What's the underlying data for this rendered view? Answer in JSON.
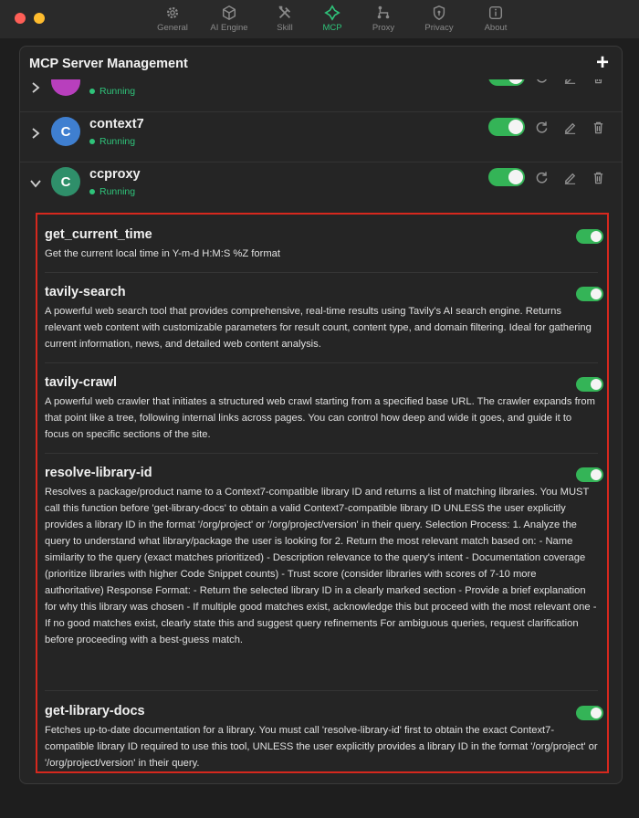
{
  "tabs": [
    {
      "label": "General",
      "icon": "gear-icon"
    },
    {
      "label": "AI Engine",
      "icon": "cube-icon"
    },
    {
      "label": "Skill",
      "icon": "tools-icon"
    },
    {
      "label": "MCP",
      "icon": "mcp-icon",
      "active": true
    },
    {
      "label": "Proxy",
      "icon": "proxy-icon"
    },
    {
      "label": "Privacy",
      "icon": "shield-icon"
    },
    {
      "label": "About",
      "icon": "info-icon"
    }
  ],
  "panel": {
    "title": "MCP Server Management",
    "add_label": "+"
  },
  "servers": [
    {
      "name": "",
      "status": "Running",
      "avatar_letter": "",
      "avatar_color": "#b83fbd",
      "expanded": false,
      "enabled": true
    },
    {
      "name": "context7",
      "status": "Running",
      "avatar_letter": "C",
      "avatar_color": "#3f7fd0",
      "expanded": false,
      "enabled": true
    },
    {
      "name": "ccproxy",
      "status": "Running",
      "avatar_letter": "C",
      "avatar_color": "#2f8f6a",
      "expanded": true,
      "enabled": true
    }
  ],
  "tools": [
    {
      "name": "get_current_time",
      "enabled": true,
      "description": "Get the current local time in Y-m-d H:M:S %Z format"
    },
    {
      "name": "tavily-search",
      "enabled": true,
      "description": "A powerful web search tool that provides comprehensive, real-time results using Tavily's AI search engine. Returns relevant web content with customizable parameters for result count, content type, and domain filtering. Ideal for gathering current information, news, and detailed web content analysis."
    },
    {
      "name": "tavily-crawl",
      "enabled": true,
      "description": "A powerful web crawler that initiates a structured web crawl starting from a specified base URL. The crawler expands from that point like a tree, following internal links across pages. You can control how deep and wide it goes, and guide it to focus on specific sections of the site."
    },
    {
      "name": "resolve-library-id",
      "enabled": true,
      "description": "Resolves a package/product name to a Context7-compatible library ID and returns a list of matching libraries. You MUST call this function before 'get-library-docs' to obtain a valid Context7-compatible library ID UNLESS the user explicitly provides a library ID in the format '/org/project' or '/org/project/version' in their query. Selection Process: 1. Analyze the query to understand what library/package the user is looking for 2. Return the most relevant match based on: - Name similarity to the query (exact matches prioritized) - Description relevance to the query's intent - Documentation coverage (prioritize libraries with higher Code Snippet counts) - Trust score (consider libraries with scores of 7-10 more authoritative) Response Format: - Return the selected library ID in a clearly marked section - Provide a brief explanation for why this library was chosen - If multiple good matches exist, acknowledge this but proceed with the most relevant one - If no good matches exist, clearly state this and suggest query refinements For ambiguous queries, request clarification before proceeding with a best-guess match."
    },
    {
      "name": "get-library-docs",
      "enabled": true,
      "description": "Fetches up-to-date documentation for a library. You must call 'resolve-library-id' first to obtain the exact Context7-compatible library ID required to use this tool, UNLESS the user explicitly provides a library ID in the format '/org/project' or '/org/project/version' in their query."
    }
  ],
  "colors": {
    "accent": "#2fc37a",
    "toggle": "#34b457",
    "highlight_border": "#d6281e"
  }
}
